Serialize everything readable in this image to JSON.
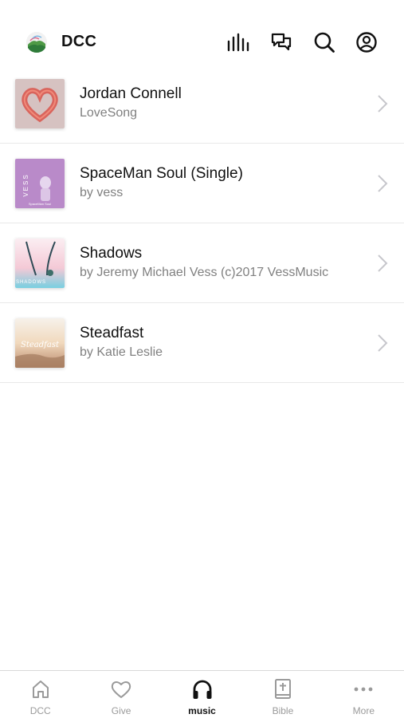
{
  "header": {
    "title": "DCC",
    "icons": [
      "equalizer-icon",
      "chat-icon",
      "search-icon",
      "profile-icon"
    ]
  },
  "music_list": [
    {
      "title": "Jordan Connell",
      "subtitle": "LoveSong",
      "artwork": "heart-artwork"
    },
    {
      "title": "SpaceMan Soul (Single)",
      "subtitle": "by vess",
      "artwork": "spaceman-artwork",
      "artwork_text": [
        "VESS",
        "SpaceMan Soul"
      ]
    },
    {
      "title": "Shadows",
      "subtitle": "by Jeremy Michael Vess (c)2017 VessMusic",
      "artwork": "shadows-artwork",
      "artwork_text": [
        "SHADOWS"
      ]
    },
    {
      "title": "Steadfast",
      "subtitle": "by Katie Leslie",
      "artwork": "steadfast-artwork",
      "artwork_text": [
        "Steadfast"
      ]
    }
  ],
  "tabbar": {
    "active": "music",
    "tabs": [
      {
        "label": "DCC",
        "icon": "home-icon"
      },
      {
        "label": "Give",
        "icon": "heart-icon"
      },
      {
        "label": "music",
        "icon": "headphones-icon"
      },
      {
        "label": "Bible",
        "icon": "bible-icon"
      },
      {
        "label": "More",
        "icon": "more-dots-icon"
      }
    ]
  },
  "colors": {
    "text_primary": "#111111",
    "text_secondary": "#808080",
    "tab_inactive": "#9a9a9a",
    "divider": "#e9e9e9"
  }
}
